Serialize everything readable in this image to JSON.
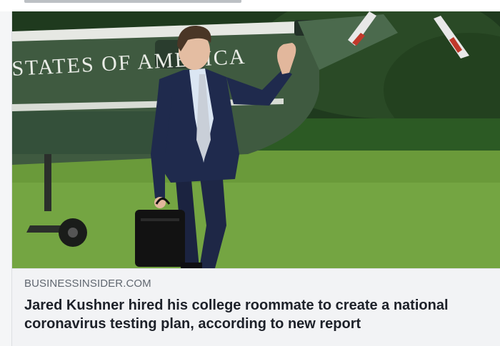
{
  "post": {
    "image_alt": "Jared Kushner waving while walking away from a helicopter",
    "painted_text": "STATES OF AMERICA",
    "domain": "BUSINESSINSIDER.COM",
    "headline": "Jared Kushner hired his college roommate to create a national coronavirus testing plan, according to new report"
  },
  "colors": {
    "lawn": "#6a9a3a",
    "helicopter_green": "#3f5a40",
    "card_background": "#f2f3f5",
    "domain_text": "#606770",
    "headline_text": "#1d2129"
  }
}
